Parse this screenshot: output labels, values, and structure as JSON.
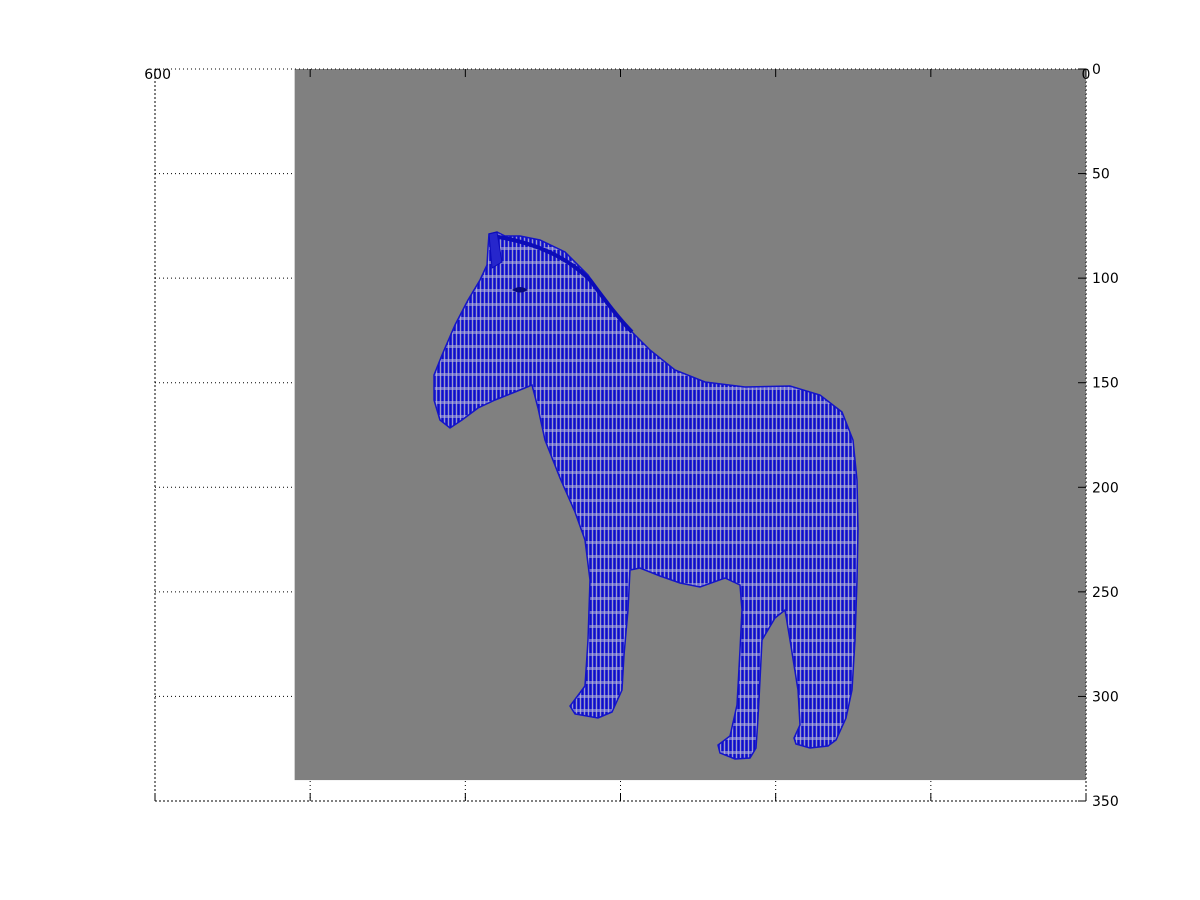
{
  "chart_data": {
    "type": "image",
    "title": "",
    "xlabel": "",
    "ylabel": "",
    "xlim": [
      0,
      600
    ],
    "ylim": [
      0,
      350
    ],
    "x_axis_reversed": true,
    "y_axis_reversed": true,
    "y_axis_position": "right",
    "grid": true,
    "grid_style": "dotted",
    "x_tick_values": [
      0,
      100,
      200,
      300,
      400,
      500,
      600
    ],
    "x_tick_labels_visible": [
      "600",
      "0"
    ],
    "y_tick_values": [
      0,
      50,
      100,
      150,
      200,
      250,
      300,
      350
    ],
    "y_tick_labels": [
      "0",
      "50",
      "100",
      "150",
      "200",
      "250",
      "300",
      "350"
    ],
    "image_extent": {
      "x": [
        0,
        510
      ],
      "y": [
        0,
        340
      ]
    },
    "image_background_color": "#808080",
    "subject": "zebra",
    "subject_color": "#1a1adb"
  }
}
